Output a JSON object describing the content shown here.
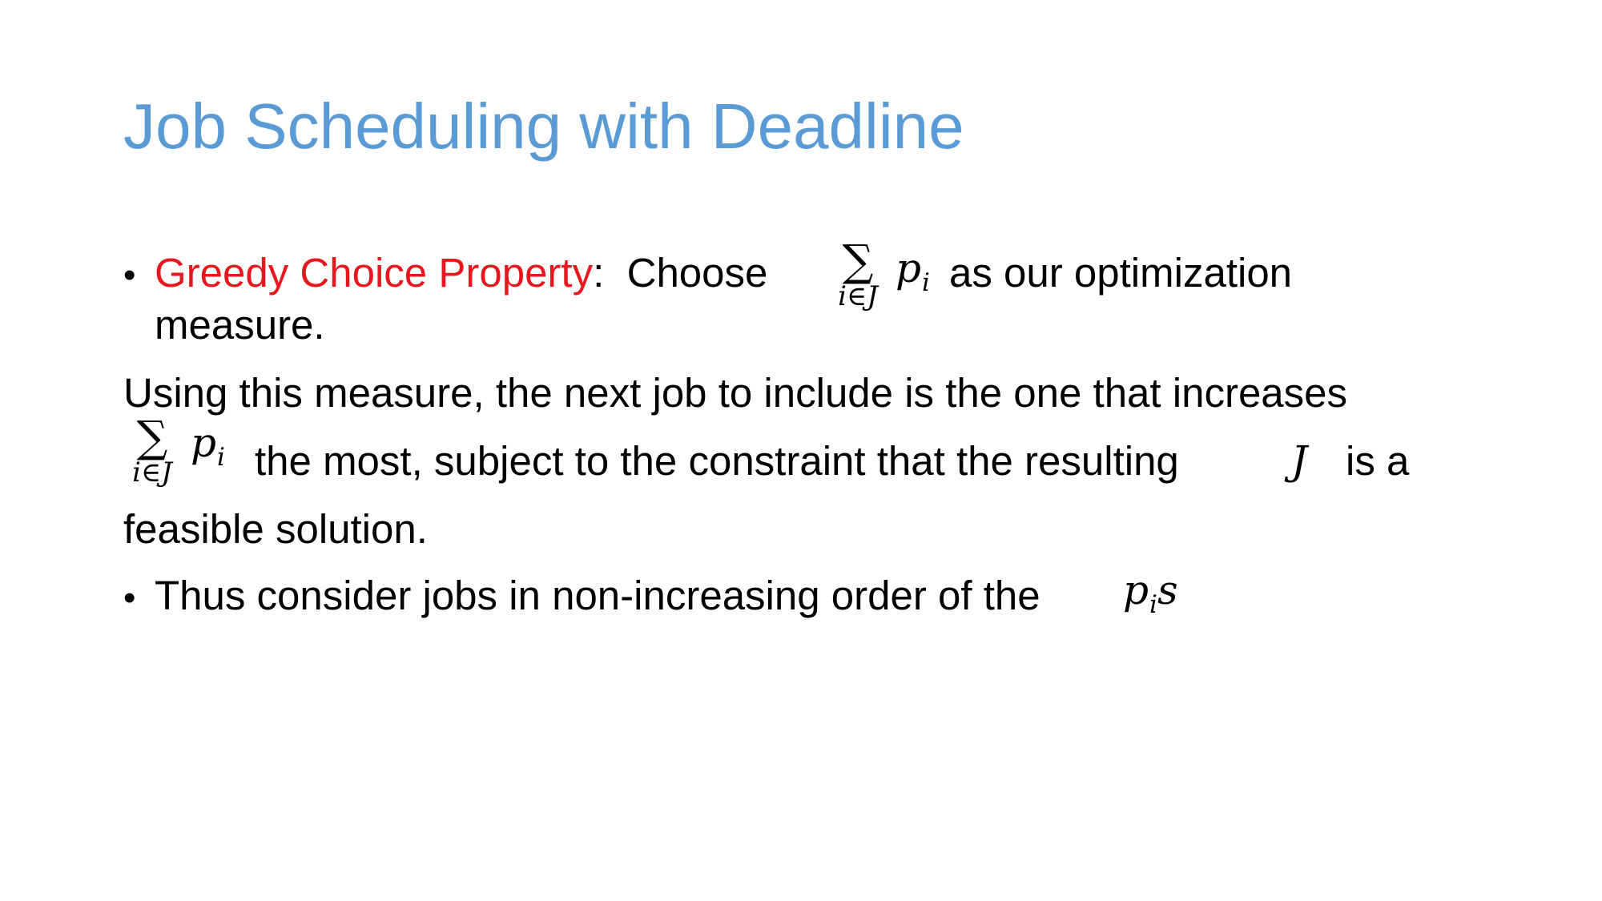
{
  "slide": {
    "title": "Job Scheduling with Deadline",
    "bullet_symbol": "•",
    "greedy_label": "Greedy Choice Property",
    "greedy_colon": ":",
    "greedy_choose": "Choose",
    "greedy_after_sum": "as our optimization",
    "greedy_line2": "measure.",
    "para_line1": "Using this measure, the next job to include is the one that increases",
    "para_line2_mid": "the most, subject to the constraint that the resulting",
    "para_line2_end": "is a",
    "para_line3": "feasible solution.",
    "thus_text": "Thus consider jobs in non-increasing order of the",
    "math": {
      "sigma": "∑",
      "sum_index": "i∈J",
      "p": "p",
      "i": "i",
      "J": "J",
      "s": "s"
    },
    "colors": {
      "title": "#5B9BD5",
      "highlight": "#E8171D",
      "text": "#000000"
    }
  }
}
